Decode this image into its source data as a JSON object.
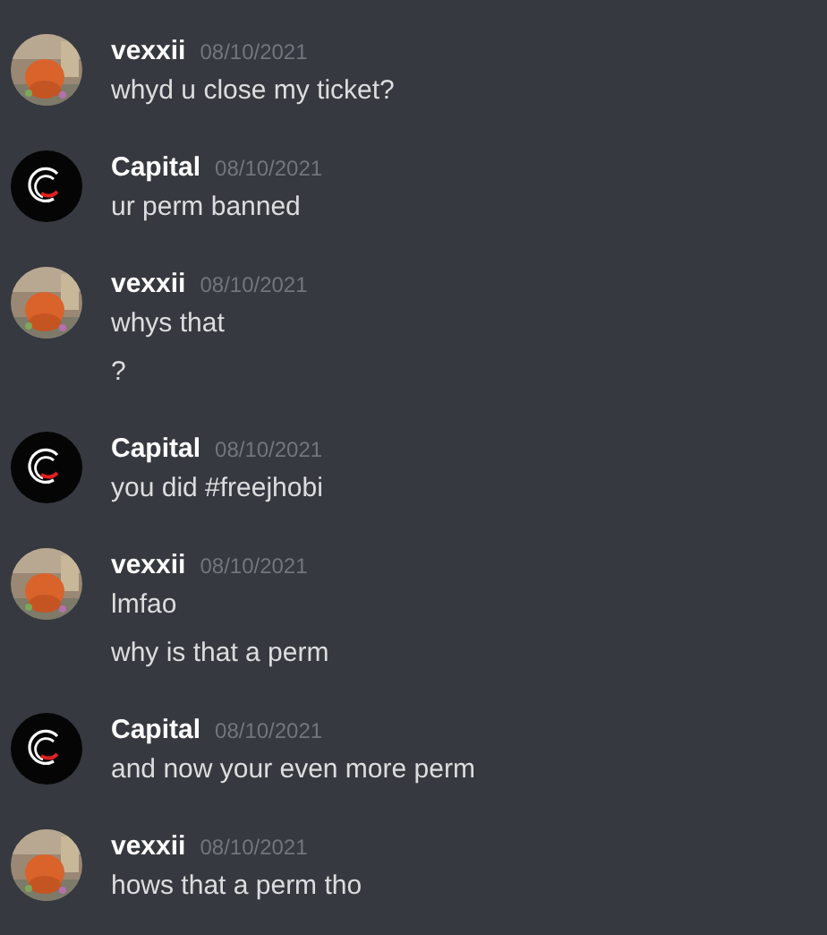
{
  "messages": [
    {
      "kind": "picture",
      "author": "vexxii",
      "timestamp": "08/10/2021",
      "lines": [
        "whyd u close my ticket?"
      ]
    },
    {
      "kind": "logo",
      "author": "Capital",
      "timestamp": "08/10/2021",
      "lines": [
        "ur perm banned"
      ]
    },
    {
      "kind": "picture",
      "author": "vexxii",
      "timestamp": "08/10/2021",
      "lines": [
        "whys that",
        "?"
      ]
    },
    {
      "kind": "logo",
      "author": "Capital",
      "timestamp": "08/10/2021",
      "lines": [
        "you did #freejhobi"
      ]
    },
    {
      "kind": "picture",
      "author": "vexxii",
      "timestamp": "08/10/2021",
      "lines": [
        "lmfao",
        "why is that a perm"
      ]
    },
    {
      "kind": "logo",
      "author": "Capital",
      "timestamp": "08/10/2021",
      "lines": [
        "and now your even more perm"
      ]
    },
    {
      "kind": "picture",
      "author": "vexxii",
      "timestamp": "08/10/2021",
      "lines": [
        "hows that a perm tho"
      ]
    }
  ]
}
